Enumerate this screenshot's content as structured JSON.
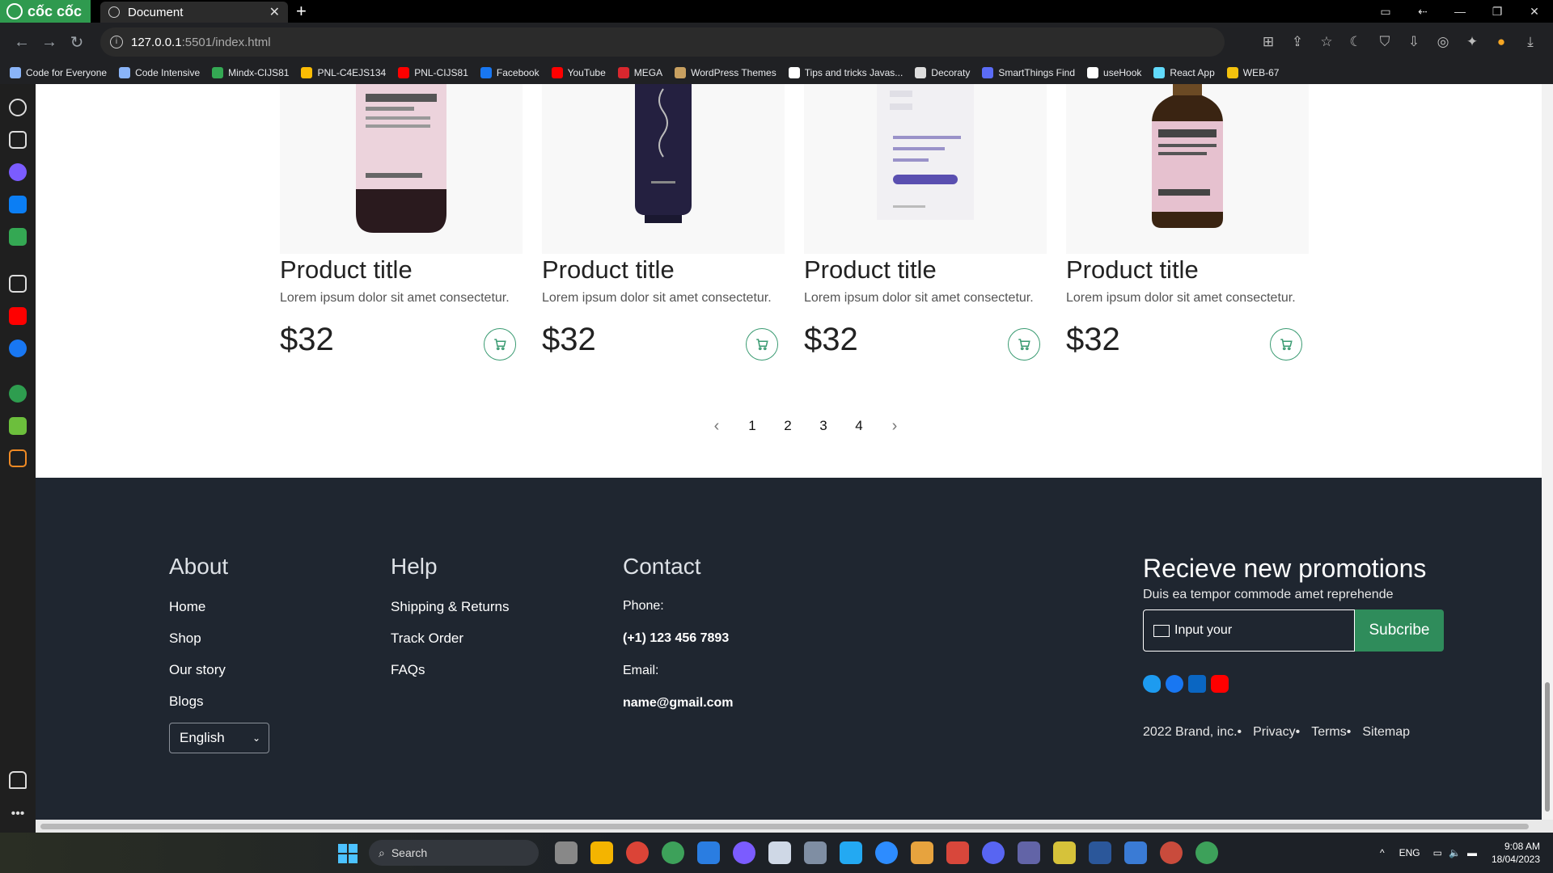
{
  "browser": {
    "brand": "cốc cốc",
    "tab_title": "Document",
    "url_host": "127.0.0.1",
    "url_path": ":5501/index.html",
    "bookmarks": [
      {
        "label": "Code for Everyone",
        "color": "#8ab4f8"
      },
      {
        "label": "Code Intensive",
        "color": "#8ab4f8"
      },
      {
        "label": "Mindx-CIJS81",
        "color": "#34a853"
      },
      {
        "label": "PNL-C4EJS134",
        "color": "#fbbc04"
      },
      {
        "label": "PNL-CIJS81",
        "color": "#ff0000"
      },
      {
        "label": "Facebook",
        "color": "#1877f2"
      },
      {
        "label": "YouTube",
        "color": "#ff0000"
      },
      {
        "label": "MEGA",
        "color": "#d9272e"
      },
      {
        "label": "WordPress Themes",
        "color": "#c8a060"
      },
      {
        "label": "Tips and tricks Javas...",
        "color": "#ffffff"
      },
      {
        "label": "Decoraty",
        "color": "#dddddd"
      },
      {
        "label": "SmartThings Find",
        "color": "#5b6cf7"
      },
      {
        "label": "useHook",
        "color": "#ffffff"
      },
      {
        "label": "React App",
        "color": "#61dafb"
      },
      {
        "label": "WEB-67",
        "color": "#f4c20d"
      }
    ]
  },
  "products": [
    {
      "title": "Product title",
      "desc": "Lorem ipsum dolor sit amet consectetur.",
      "price": "$32"
    },
    {
      "title": "Product title",
      "desc": "Lorem ipsum dolor sit amet consectetur.",
      "price": "$32"
    },
    {
      "title": "Product title",
      "desc": "Lorem ipsum dolor sit amet consectetur.",
      "price": "$32"
    },
    {
      "title": "Product title",
      "desc": "Lorem ipsum dolor sit amet consectetur.",
      "price": "$32"
    }
  ],
  "pagination": {
    "pages": [
      "1",
      "2",
      "3",
      "4"
    ],
    "prev": "‹",
    "next": "›"
  },
  "footer": {
    "about": {
      "heading": "About",
      "links": [
        "Home",
        "Shop",
        "Our story",
        "Blogs"
      ],
      "language": "English"
    },
    "help": {
      "heading": "Help",
      "links": [
        "Shipping & Returns",
        "Track Order",
        "FAQs"
      ]
    },
    "contact": {
      "heading": "Contact",
      "phone_label": "Phone:",
      "phone": "(+1) 123 456 7893",
      "email_label": "Email:",
      "email": "name@gmail.com"
    },
    "promo": {
      "heading": "Recieve new promotions",
      "sub": "Duis ea tempor commode amet reprehende",
      "input_placeholder": "Input your",
      "button": "Subcribe",
      "social": [
        "twitter-icon",
        "facebook-icon",
        "linkedin-icon",
        "youtube-icon"
      ],
      "legal": [
        "2022 Brand, inc.•",
        "Privacy•",
        "Terms•",
        "Sitemap"
      ]
    }
  },
  "taskbar": {
    "search": "Search",
    "lang": "ENG",
    "time": "9:08 AM",
    "date": "18/04/2023"
  }
}
